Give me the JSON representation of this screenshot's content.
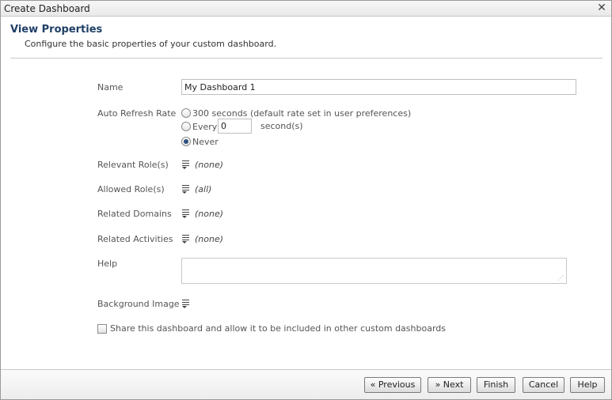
{
  "window": {
    "title": "Create Dashboard",
    "close_glyph": "✕"
  },
  "header": {
    "title": "View Properties",
    "description": "Configure the basic properties of your custom dashboard."
  },
  "form": {
    "name": {
      "label": "Name",
      "value": "My Dashboard 1"
    },
    "auto_refresh": {
      "label": "Auto Refresh Rate",
      "options": [
        {
          "label": "300 seconds (default rate set in user preferences)",
          "checked": false
        },
        {
          "label": "Every",
          "checked": false,
          "input_value": "0",
          "suffix": "second(s)"
        },
        {
          "label": "Never",
          "checked": true
        }
      ]
    },
    "relevant_roles": {
      "label": "Relevant Role(s)",
      "value": "(none)",
      "icon": "list-picker-icon"
    },
    "allowed_roles": {
      "label": "Allowed Role(s)",
      "value": "(all)",
      "icon": "list-picker-icon"
    },
    "related_domains": {
      "label": "Related Domains",
      "value": "(none)",
      "icon": "list-picker-icon"
    },
    "related_activities": {
      "label": "Related Activities",
      "value": "(none)",
      "icon": "list-picker-icon"
    },
    "help": {
      "label": "Help",
      "value": ""
    },
    "background_image": {
      "label": "Background Image",
      "icon": "list-picker-icon"
    },
    "share": {
      "label": "Share this dashboard and allow it to be included in other custom dashboards",
      "checked": false
    }
  },
  "footer": {
    "previous_label": "« Previous",
    "next_label": "» Next",
    "finish_label": "Finish",
    "cancel_label": "Cancel",
    "help_label": "Help"
  },
  "colors": {
    "header_title": "#1f3f66",
    "radio_dot": "#2c4f7c"
  }
}
